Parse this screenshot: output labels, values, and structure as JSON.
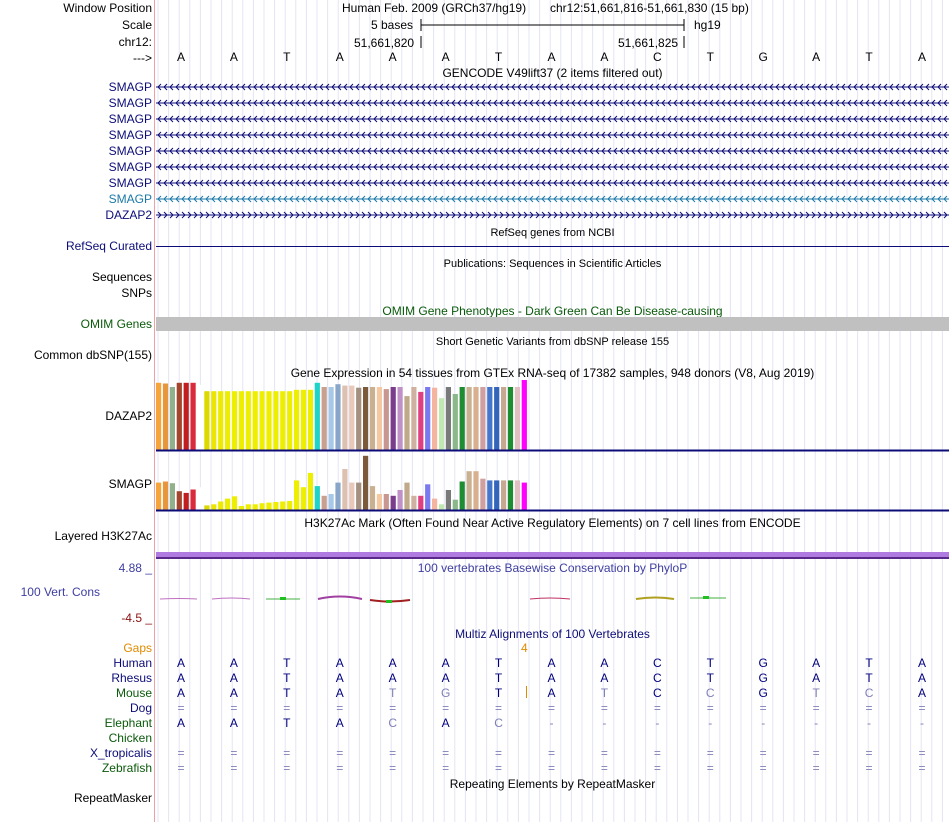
{
  "ruler": {
    "window_position_label": "Window Position",
    "scale_label": "Scale",
    "chrom_label": "chr12:",
    "strand_label": "--->",
    "genome_title": "Human Feb. 2009 (GRCh37/hg19)",
    "position_text": "chr12:51,661,816-51,661,830 (15 bp)",
    "scale_text": "5 bases",
    "assembly": "hg19",
    "coord_left": "51,661,820",
    "coord_right": "51,661,825",
    "bases": [
      "A",
      "A",
      "T",
      "A",
      "A",
      "A",
      "T",
      "A",
      "A",
      "C",
      "T",
      "G",
      "A",
      "T",
      "A"
    ]
  },
  "gencode": {
    "title": "GENCODE V49lift37 (2 items filtered out)",
    "tracks": [
      {
        "name": "SMAGP",
        "dir": "minus",
        "color": "#0c0c78"
      },
      {
        "name": "SMAGP",
        "dir": "minus",
        "color": "#0c0c78"
      },
      {
        "name": "SMAGP",
        "dir": "minus",
        "color": "#0c0c78"
      },
      {
        "name": "SMAGP",
        "dir": "minus",
        "color": "#0c0c78"
      },
      {
        "name": "SMAGP",
        "dir": "minus",
        "color": "#0c0c78"
      },
      {
        "name": "SMAGP",
        "dir": "minus",
        "color": "#0c0c78"
      },
      {
        "name": "SMAGP",
        "dir": "minus",
        "color": "#0c0c78"
      },
      {
        "name": "SMAGP",
        "dir": "minus",
        "color": "#1a79a8"
      },
      {
        "name": "DAZAP2",
        "dir": "plus",
        "color": "#0c0c78"
      }
    ]
  },
  "refseq": {
    "title": "RefSeq genes from NCBI",
    "label": "RefSeq Curated"
  },
  "publications": {
    "title": "Publications: Sequences in Scientific Articles",
    "label_sequences": "Sequences",
    "label_snps": "SNPs"
  },
  "omim": {
    "title": "OMIM Gene Phenotypes - Dark Green Can Be Disease-causing",
    "label": "OMIM Genes",
    "bar_color": "#c0c0c0"
  },
  "dbsnp": {
    "title": "Short Genetic Variants from dbSNP release 155",
    "label": "Common dbSNP(155)"
  },
  "gtex": {
    "title": "Gene Expression in 54 tissues from GTEx RNA-seq of 17382 samples, 948 donors (V8, Aug 2019)",
    "genes": [
      {
        "name": "DAZAP2",
        "values": [
          0.96,
          0.95,
          0.9,
          0.96,
          0.96,
          0.96,
          0.93,
          0.84,
          0.84,
          0.84,
          0.84,
          0.84,
          0.84,
          0.84,
          0.84,
          0.84,
          0.84,
          0.84,
          0.84,
          0.84,
          0.86,
          0.86,
          0.86,
          0.96,
          0.9,
          0.9,
          0.94,
          0.92,
          0.92,
          0.89,
          0.9,
          0.9,
          0.9,
          0.87,
          0.9,
          0.9,
          0.77,
          0.9,
          0.83,
          0.9,
          0.89,
          0.74,
          0.9,
          0.8,
          0.9,
          0.9,
          0.9,
          0.9,
          0.9,
          0.9,
          0.9,
          0.9,
          0.9,
          1.0
        ]
      },
      {
        "name": "SMAGP",
        "values": [
          0.48,
          0.5,
          0.47,
          0.33,
          0.3,
          0.36,
          0.4,
          0.08,
          0.1,
          0.15,
          0.2,
          0.24,
          0.07,
          0.1,
          0.1,
          0.12,
          0.13,
          0.14,
          0.15,
          0.16,
          0.52,
          0.4,
          0.65,
          0.42,
          0.25,
          0.28,
          0.48,
          0.72,
          0.48,
          0.48,
          0.95,
          0.42,
          0.28,
          0.28,
          0.25,
          0.35,
          0.48,
          0.25,
          0.25,
          0.45,
          0.2,
          0.1,
          0.35,
          0.18,
          0.5,
          0.68,
          0.68,
          0.55,
          0.52,
          0.52,
          0.52,
          0.52,
          0.52,
          0.48
        ]
      }
    ],
    "colors": [
      "#f4a43a",
      "#e8963c",
      "#93b08c",
      "#a3442f",
      "#c11f1f",
      "#d92b3a",
      "#ffffff",
      "#dcd800",
      "#ebe600",
      "#ecea00",
      "#eded00",
      "#eeee00",
      "#eeee00",
      "#eeee00",
      "#eeee00",
      "#eeee00",
      "#eeee00",
      "#eeee00",
      "#eeee00",
      "#eeee00",
      "#eeee00",
      "#eeee00",
      "#eeee00",
      "#1fd3c8",
      "#c8a090",
      "#a8c8e8",
      "#89a6c8",
      "#dcc0b0",
      "#e8c8b8",
      "#a39080",
      "#7a5a3a",
      "#c8b090",
      "#f4c8a0",
      "#c89890",
      "#7a3d8c",
      "#c090c8",
      "#c0a88a",
      "#d0b0a0",
      "#e04080",
      "#7a7aee",
      "#f4b4a0",
      "#c0e8b0",
      "#7a7a7a",
      "#8ab88a",
      "#1e8c30",
      "#c8b090",
      "#d8b090",
      "#d0a0a0",
      "#4477cc",
      "#3366bb",
      "#c8a890",
      "#1e8c30",
      "#e0c0c0",
      "#ff00ff"
    ]
  },
  "h3k27ac": {
    "title": "H3K27Ac Mark (Often Found Near Active Regulatory Elements) on 7 cell lines from ENCODE",
    "label": "Layered H3K27Ac"
  },
  "conservation": {
    "title": "100 vertebrates Basewise Conservation by PhyloP",
    "label": "100 Vert. Cons",
    "max_label": "4.88 _",
    "min_label": "-4.5 _"
  },
  "multiz": {
    "title": "Multiz Alignments of 100 Vertebrates",
    "gaps_label": "Gaps",
    "gap_count": "4",
    "species": [
      {
        "name": "Human",
        "color": "#0c0c78",
        "row": [
          "A",
          "A",
          "T",
          "A",
          "A",
          "A",
          "T",
          "A",
          "A",
          "C",
          "T",
          "G",
          "A",
          "T",
          "A"
        ],
        "kind": [
          "i",
          "i",
          "i",
          "i",
          "i",
          "i",
          "i",
          "i",
          "i",
          "i",
          "i",
          "i",
          "i",
          "i",
          "i"
        ]
      },
      {
        "name": "Rhesus",
        "color": "#0c0c78",
        "row": [
          "A",
          "A",
          "T",
          "A",
          "A",
          "A",
          "T",
          "A",
          "A",
          "C",
          "T",
          "G",
          "A",
          "T",
          "A"
        ],
        "kind": [
          "i",
          "i",
          "i",
          "i",
          "i",
          "i",
          "i",
          "i",
          "i",
          "i",
          "i",
          "i",
          "i",
          "i",
          "i"
        ]
      },
      {
        "name": "Mouse",
        "color": "#0a5a0a",
        "row": [
          "A",
          "A",
          "T",
          "A",
          "T",
          "G",
          "T",
          "A",
          "T",
          "C",
          "C",
          "G",
          "T",
          "C",
          "A"
        ],
        "kind": [
          "i",
          "i",
          "i",
          "i",
          "d",
          "d",
          "i",
          "i",
          "d",
          "i",
          "d",
          "i",
          "d",
          "d",
          "i"
        ]
      },
      {
        "name": "Dog",
        "color": "#0c0c78",
        "row": [
          "=",
          "=",
          "=",
          "=",
          "=",
          "=",
          "=",
          "=",
          "=",
          "=",
          "=",
          "=",
          "=",
          "=",
          "="
        ],
        "kind": [
          "e",
          "e",
          "e",
          "e",
          "e",
          "e",
          "e",
          "e",
          "e",
          "e",
          "e",
          "e",
          "e",
          "e",
          "e"
        ]
      },
      {
        "name": "Elephant",
        "color": "#0a5a0a",
        "row": [
          "A",
          "A",
          "T",
          "A",
          "C",
          "A",
          "C",
          "-",
          "-",
          "-",
          "-",
          "-",
          "-",
          "-",
          "-"
        ],
        "kind": [
          "i",
          "i",
          "i",
          "i",
          "d",
          "i",
          "d",
          "h",
          "h",
          "h",
          "h",
          "h",
          "h",
          "h",
          "h"
        ]
      },
      {
        "name": "Chicken",
        "color": "#0a5a0a",
        "row": [
          "",
          "",
          "",
          "",
          "",
          "",
          "",
          "",
          "",
          "",
          "",
          "",
          "",
          "",
          ""
        ],
        "kind": [
          "",
          "",
          "",
          "",
          "",
          "",
          "",
          "",
          "",
          "",
          "",
          "",
          "",
          "",
          ""
        ]
      },
      {
        "name": "X_tropicalis",
        "color": "#0c0c78",
        "row": [
          "=",
          "=",
          "=",
          "=",
          "=",
          "=",
          "=",
          "=",
          "=",
          "=",
          "=",
          "=",
          "=",
          "=",
          "="
        ],
        "kind": [
          "e",
          "e",
          "e",
          "e",
          "e",
          "e",
          "e",
          "e",
          "e",
          "e",
          "e",
          "e",
          "e",
          "e",
          "e"
        ]
      },
      {
        "name": "Zebrafish",
        "color": "#0a5a0a",
        "row": [
          "=",
          "=",
          "=",
          "=",
          "=",
          "=",
          "=",
          "=",
          "=",
          "=",
          "=",
          "=",
          "=",
          "=",
          "="
        ],
        "kind": [
          "e",
          "e",
          "e",
          "e",
          "e",
          "e",
          "e",
          "e",
          "e",
          "e",
          "e",
          "e",
          "e",
          "e",
          "e"
        ]
      }
    ]
  },
  "repeatmasker": {
    "title": "Repeating Elements by RepeatMasker",
    "label": "RepeatMasker"
  }
}
